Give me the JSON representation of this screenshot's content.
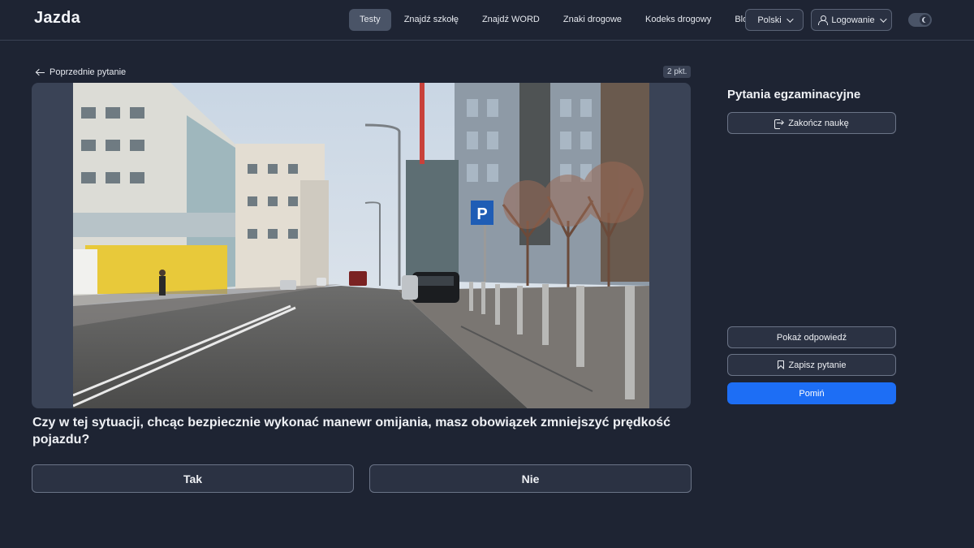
{
  "header": {
    "logo": "Jazda",
    "nav": [
      {
        "label": "Testy",
        "active": true
      },
      {
        "label": "Znajdź szkołę",
        "active": false
      },
      {
        "label": "Znajdź WORD",
        "active": false
      },
      {
        "label": "Znaki drogowe",
        "active": false
      },
      {
        "label": "Kodeks drogowy",
        "active": false
      },
      {
        "label": "Blog",
        "active": false
      }
    ],
    "language": "Polski",
    "login": "Logowanie",
    "theme_toggle_icon": "moon-icon"
  },
  "question": {
    "back_label": "Poprzednie pytanie",
    "points": "2 pkt.",
    "text": "Czy w tej sytuacji, chcąc bezpiecznie wykonać manewr omijania, masz obowiązek zmniejszyć prędkość pojazdu?",
    "answers": [
      "Tak",
      "Nie"
    ],
    "media_sign": "P"
  },
  "sidebar": {
    "title": "Pytania egzaminacyjne",
    "end_label": "Zakończ naukę",
    "show_answer_label": "Pokaż odpowiedź",
    "save_label": "Zapisz pytanie",
    "skip_label": "Pomiń"
  },
  "colors": {
    "background": "#1e2433",
    "accent": "#1d6ef5",
    "button_border": "#6b7487"
  }
}
